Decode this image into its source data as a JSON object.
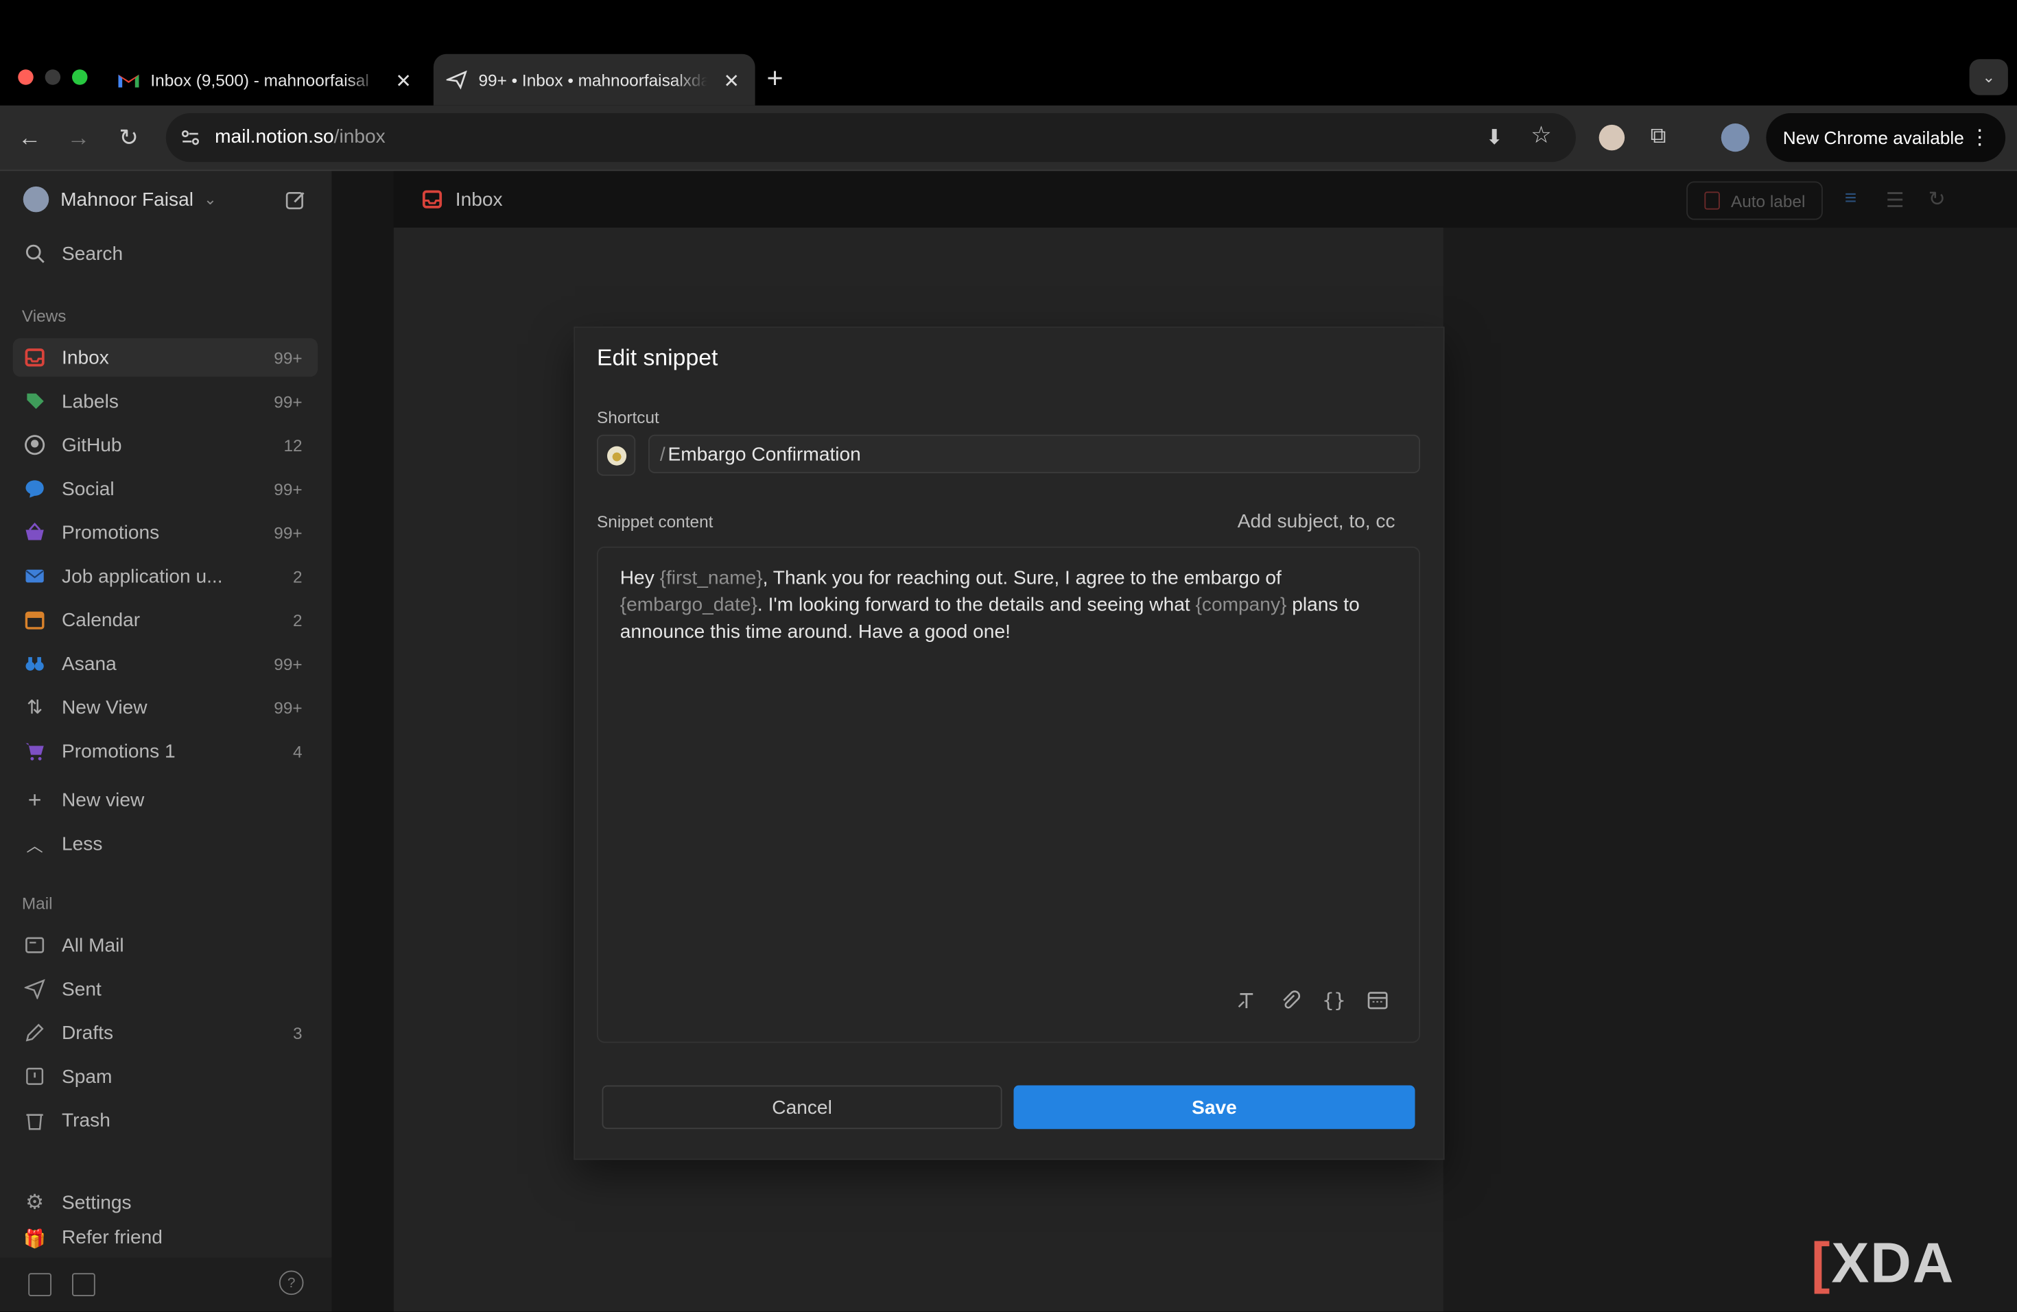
{
  "browser": {
    "tabs": [
      {
        "title": "Inbox (9,500) - mahnoorfaisal",
        "close": "✕"
      },
      {
        "title": "99+ • Inbox • mahnoorfaisalxda",
        "close": "✕"
      }
    ],
    "new_tab": "+",
    "url_host": "mail.notion.so",
    "url_path": "/inbox",
    "update_label": "New Chrome available"
  },
  "sidebar": {
    "account_name": "Mahnoor Faisal",
    "search_label": "Search",
    "views_heading": "Views",
    "views": [
      {
        "label": "Inbox",
        "count": "99+"
      },
      {
        "label": "Labels",
        "count": "99+"
      },
      {
        "label": "GitHub",
        "count": "12"
      },
      {
        "label": "Social",
        "count": "99+"
      },
      {
        "label": "Promotions",
        "count": "99+"
      },
      {
        "label": "Job application u...",
        "count": "2"
      },
      {
        "label": "Calendar",
        "count": "2"
      },
      {
        "label": "Asana",
        "count": "99+"
      },
      {
        "label": "New View",
        "count": "99+"
      },
      {
        "label": "Promotions 1",
        "count": "4"
      }
    ],
    "new_view_label": "New view",
    "less_label": "Less",
    "mail_heading": "Mail",
    "mail": [
      {
        "label": "All Mail",
        "count": ""
      },
      {
        "label": "Sent",
        "count": ""
      },
      {
        "label": "Drafts",
        "count": "3"
      },
      {
        "label": "Spam",
        "count": ""
      },
      {
        "label": "Trash",
        "count": ""
      }
    ],
    "settings_label": "Settings",
    "refer_label": "Refer friend"
  },
  "main": {
    "title": "Inbox",
    "auto_label": "Auto label"
  },
  "modal": {
    "title": "Edit snippet",
    "shortcut_label": "Shortcut",
    "shortcut_slash": "/",
    "shortcut_value": "Embargo Confirmation",
    "content_label": "Snippet content",
    "add_fields_label": "Add subject, to, cc",
    "content": {
      "t1": "Hey ",
      "v1": "{first_name}",
      "t2": ", Thank you for reaching out. Sure, I agree to the embargo of ",
      "v2": "{embargo_date}",
      "t3": ". I'm looking forward to the details and seeing what ",
      "v3": "{company}",
      "t4": " plans to announce this time around. Have a good one!"
    },
    "cancel_label": "Cancel",
    "save_label": "Save"
  },
  "watermark": "XDA",
  "colors": {
    "accent": "#2383e2",
    "inbox_red": "#d9433b",
    "labels_green": "#3f9c5a",
    "social_blue": "#2f7fd6",
    "promotions_purple": "#7d4fc4",
    "job_blue": "#3d7fd9",
    "calendar_orange": "#d9822b"
  }
}
